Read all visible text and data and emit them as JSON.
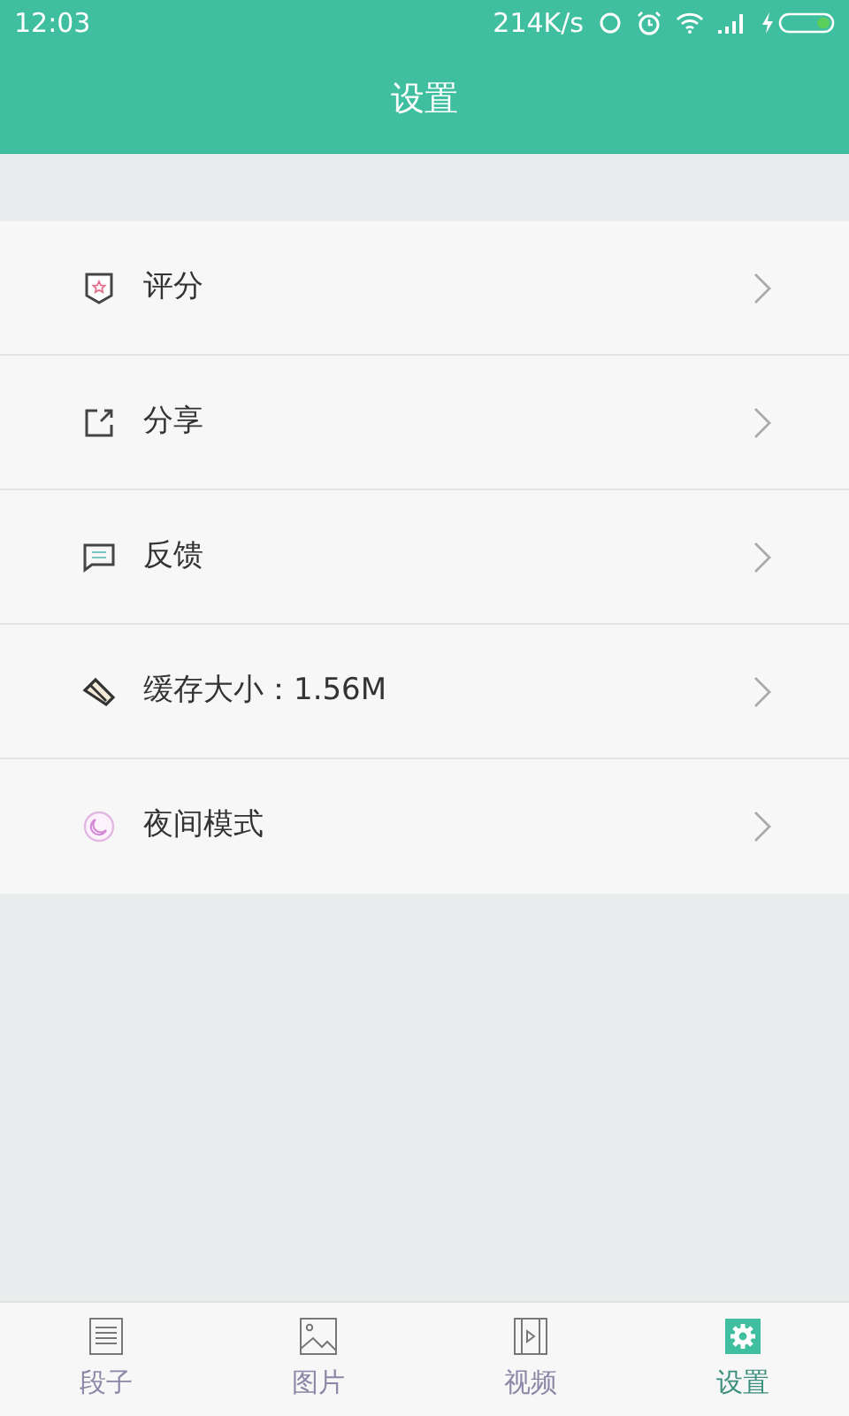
{
  "status_bar": {
    "time": "12:03",
    "speed": "214K/s"
  },
  "header": {
    "title": "设置"
  },
  "menu": [
    {
      "kind": "rate",
      "label": "评分"
    },
    {
      "kind": "share",
      "label": "分享"
    },
    {
      "kind": "feedback",
      "label": "反馈"
    },
    {
      "kind": "cache",
      "label": "缓存大小：1.56M"
    },
    {
      "kind": "night",
      "label": "夜间模式"
    }
  ],
  "tabs": [
    {
      "kind": "text",
      "label": "段子",
      "selected": false
    },
    {
      "kind": "image",
      "label": "图片",
      "selected": false
    },
    {
      "kind": "video",
      "label": "视频",
      "selected": false
    },
    {
      "kind": "settings",
      "label": "设置",
      "selected": true
    }
  ]
}
